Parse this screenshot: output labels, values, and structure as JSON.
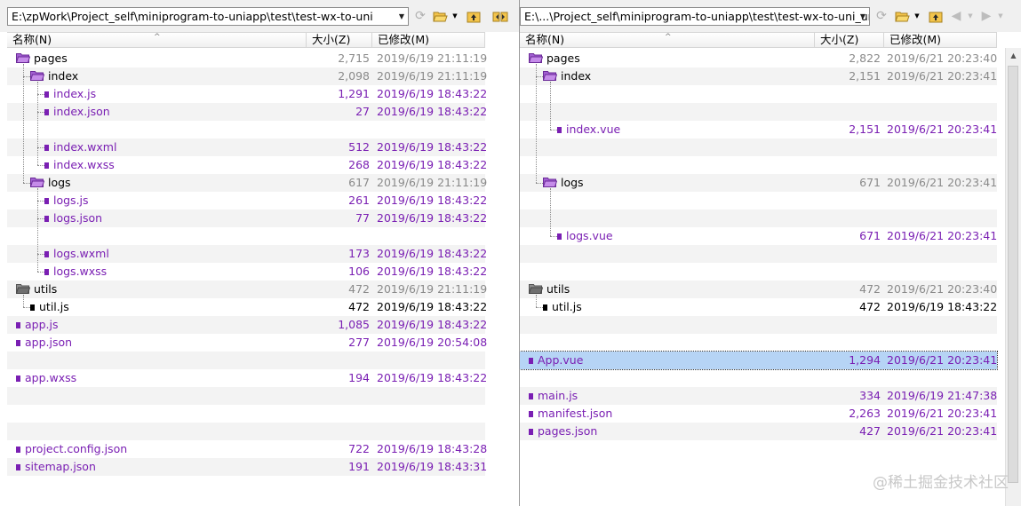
{
  "left": {
    "path": "E:\\zpWork\\Project_self\\miniprogram-to-uniapp\\test\\test-wx-to-uni",
    "columns": {
      "name": "名称(N)",
      "size": "大小(Z)",
      "modified": "已修改(M)"
    },
    "rows": [
      {
        "name": "pages",
        "size": "2,715",
        "date": "2019/6/19 21:11:19",
        "kind": "folder-open",
        "level": 0,
        "color": "black",
        "meta": "gray"
      },
      {
        "name": "index",
        "size": "2,098",
        "date": "2019/6/19 21:11:19",
        "kind": "folder-open",
        "level": 1,
        "color": "black",
        "meta": "gray"
      },
      {
        "name": "index.js",
        "size": "1,291",
        "date": "2019/6/19 18:43:22",
        "kind": "file",
        "level": 2,
        "color": "purple",
        "meta": "purple"
      },
      {
        "name": "index.json",
        "size": "27",
        "date": "2019/6/19 18:43:22",
        "kind": "file",
        "level": 2,
        "color": "purple",
        "meta": "purple"
      },
      {
        "name": "",
        "size": "",
        "date": "",
        "kind": "blank",
        "level": 2
      },
      {
        "name": "index.wxml",
        "size": "512",
        "date": "2019/6/19 18:43:22",
        "kind": "file",
        "level": 2,
        "color": "purple",
        "meta": "purple"
      },
      {
        "name": "index.wxss",
        "size": "268",
        "date": "2019/6/19 18:43:22",
        "kind": "file",
        "level": 2,
        "color": "purple",
        "meta": "purple"
      },
      {
        "name": "logs",
        "size": "617",
        "date": "2019/6/19 21:11:19",
        "kind": "folder-open",
        "level": 1,
        "color": "black",
        "meta": "gray"
      },
      {
        "name": "logs.js",
        "size": "261",
        "date": "2019/6/19 18:43:22",
        "kind": "file",
        "level": 2,
        "color": "purple",
        "meta": "purple"
      },
      {
        "name": "logs.json",
        "size": "77",
        "date": "2019/6/19 18:43:22",
        "kind": "file",
        "level": 2,
        "color": "purple",
        "meta": "purple"
      },
      {
        "name": "",
        "size": "",
        "date": "",
        "kind": "blank",
        "level": 2
      },
      {
        "name": "logs.wxml",
        "size": "173",
        "date": "2019/6/19 18:43:22",
        "kind": "file",
        "level": 2,
        "color": "purple",
        "meta": "purple"
      },
      {
        "name": "logs.wxss",
        "size": "106",
        "date": "2019/6/19 18:43:22",
        "kind": "file",
        "level": 2,
        "color": "purple",
        "meta": "purple"
      },
      {
        "name": "utils",
        "size": "472",
        "date": "2019/6/19 21:11:19",
        "kind": "folder-gray",
        "level": 0,
        "color": "black",
        "meta": "gray"
      },
      {
        "name": "util.js",
        "size": "472",
        "date": "2019/6/19 18:43:22",
        "kind": "file",
        "level": 1,
        "color": "black",
        "meta": "black"
      },
      {
        "name": "app.js",
        "size": "1,085",
        "date": "2019/6/19 18:43:22",
        "kind": "file",
        "level": 0,
        "color": "purple",
        "meta": "purple"
      },
      {
        "name": "app.json",
        "size": "277",
        "date": "2019/6/19 20:54:08",
        "kind": "file",
        "level": 0,
        "color": "purple",
        "meta": "purple"
      },
      {
        "name": "",
        "size": "",
        "date": "",
        "kind": "blank",
        "level": 0
      },
      {
        "name": "app.wxss",
        "size": "194",
        "date": "2019/6/19 18:43:22",
        "kind": "file",
        "level": 0,
        "color": "purple",
        "meta": "purple"
      },
      {
        "name": "",
        "size": "",
        "date": "",
        "kind": "blank",
        "level": 0
      },
      {
        "name": "",
        "size": "",
        "date": "",
        "kind": "blank",
        "level": 0
      },
      {
        "name": "",
        "size": "",
        "date": "",
        "kind": "blank",
        "level": 0
      },
      {
        "name": "project.config.json",
        "size": "722",
        "date": "2019/6/19 18:43:28",
        "kind": "file",
        "level": 0,
        "color": "purple",
        "meta": "purple"
      },
      {
        "name": "sitemap.json",
        "size": "191",
        "date": "2019/6/19 18:43:31",
        "kind": "file",
        "level": 0,
        "color": "purple",
        "meta": "purple"
      }
    ]
  },
  "right": {
    "path": "E:\\...\\Project_self\\miniprogram-to-uniapp\\test\\test-wx-to-uni_uni",
    "columns": {
      "name": "名称(N)",
      "size": "大小(Z)",
      "modified": "已修改(M)"
    },
    "rows": [
      {
        "name": "pages",
        "size": "2,822",
        "date": "2019/6/21 20:23:40",
        "kind": "folder-open",
        "level": 0,
        "color": "black",
        "meta": "gray"
      },
      {
        "name": "index",
        "size": "2,151",
        "date": "2019/6/21 20:23:41",
        "kind": "folder-open",
        "level": 1,
        "color": "black",
        "meta": "gray"
      },
      {
        "name": "",
        "size": "",
        "date": "",
        "kind": "blank",
        "level": 2
      },
      {
        "name": "",
        "size": "",
        "date": "",
        "kind": "blank",
        "level": 2
      },
      {
        "name": "index.vue",
        "size": "2,151",
        "date": "2019/6/21 20:23:41",
        "kind": "file",
        "level": 2,
        "color": "purple",
        "meta": "purple"
      },
      {
        "name": "",
        "size": "",
        "date": "",
        "kind": "blank",
        "level": 2
      },
      {
        "name": "",
        "size": "",
        "date": "",
        "kind": "blank",
        "level": 2
      },
      {
        "name": "logs",
        "size": "671",
        "date": "2019/6/21 20:23:41",
        "kind": "folder-open",
        "level": 1,
        "color": "black",
        "meta": "gray"
      },
      {
        "name": "",
        "size": "",
        "date": "",
        "kind": "blank",
        "level": 2
      },
      {
        "name": "",
        "size": "",
        "date": "",
        "kind": "blank",
        "level": 2
      },
      {
        "name": "logs.vue",
        "size": "671",
        "date": "2019/6/21 20:23:41",
        "kind": "file",
        "level": 2,
        "color": "purple",
        "meta": "purple"
      },
      {
        "name": "",
        "size": "",
        "date": "",
        "kind": "blank",
        "level": 2
      },
      {
        "name": "",
        "size": "",
        "date": "",
        "kind": "blank",
        "level": 2
      },
      {
        "name": "utils",
        "size": "472",
        "date": "2019/6/21 20:23:40",
        "kind": "folder-gray",
        "level": 0,
        "color": "black",
        "meta": "gray"
      },
      {
        "name": "util.js",
        "size": "472",
        "date": "2019/6/19 18:43:22",
        "kind": "file",
        "level": 1,
        "color": "black",
        "meta": "black"
      },
      {
        "name": "",
        "size": "",
        "date": "",
        "kind": "blank",
        "level": 0
      },
      {
        "name": "",
        "size": "",
        "date": "",
        "kind": "blank",
        "level": 0
      },
      {
        "name": "App.vue",
        "size": "1,294",
        "date": "2019/6/21 20:23:41",
        "kind": "file",
        "level": 0,
        "color": "purple",
        "meta": "purple",
        "selected": true
      },
      {
        "name": "",
        "size": "",
        "date": "",
        "kind": "blank",
        "level": 0
      },
      {
        "name": "main.js",
        "size": "334",
        "date": "2019/6/19 21:47:38",
        "kind": "file",
        "level": 0,
        "color": "purple",
        "meta": "purple"
      },
      {
        "name": "manifest.json",
        "size": "2,263",
        "date": "2019/6/21 20:23:41",
        "kind": "file",
        "level": 0,
        "color": "purple",
        "meta": "purple"
      },
      {
        "name": "pages.json",
        "size": "427",
        "date": "2019/6/21 20:23:41",
        "kind": "file",
        "level": 0,
        "color": "purple",
        "meta": "purple"
      }
    ]
  },
  "watermark": "@稀土掘金技术社区",
  "colors": {
    "purple": "#7a1fb3",
    "gray": "#8a8a8a",
    "selection": "#b6d4f5",
    "altRow": "#f3f3f3"
  }
}
